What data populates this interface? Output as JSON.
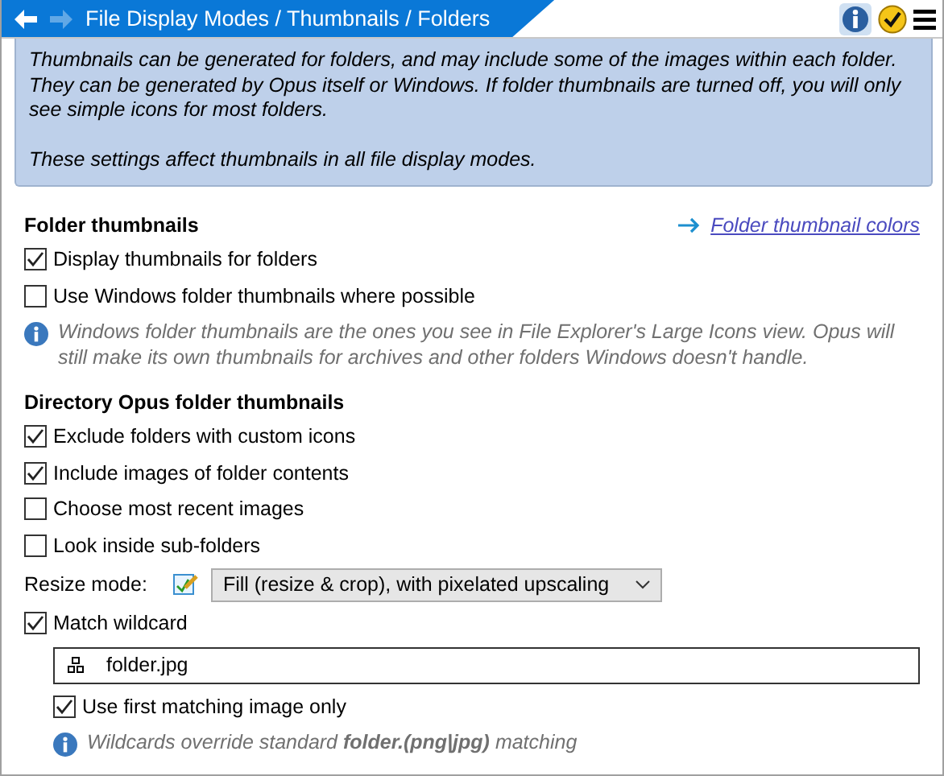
{
  "header": {
    "breadcrumb": "File Display Modes / Thumbnails / Folders",
    "back_enabled": true,
    "forward_enabled": false
  },
  "info_panel": {
    "paragraphs": [
      "Thumbnails can be generated for folders, and may include some of the images within each folder. They can be generated by Opus itself or Windows. If folder thumbnails are turned off, you will only see simple icons for most folders.",
      "These settings affect thumbnails in all file display modes."
    ]
  },
  "sections": [
    {
      "title": "Folder thumbnails",
      "link": "Folder thumbnail colors",
      "items": [
        {
          "kind": "checkbox",
          "label": "Display thumbnails for folders",
          "checked": true
        },
        {
          "kind": "checkbox",
          "label": "Use Windows folder thumbnails where possible",
          "checked": false
        },
        {
          "kind": "note",
          "text": "Windows folder thumbnails are the ones you see in File Explorer's Large Icons view. Opus will still make its own thumbnails for archives and other folders Windows doesn't handle."
        }
      ]
    },
    {
      "title": "Directory Opus folder thumbnails",
      "items": [
        {
          "kind": "checkbox",
          "label": "Exclude folders with custom icons",
          "checked": true
        },
        {
          "kind": "checkbox",
          "label": "Include images of folder contents",
          "checked": true
        },
        {
          "kind": "checkbox",
          "label": "Choose most recent images",
          "checked": false
        },
        {
          "kind": "checkbox",
          "label": "Look inside sub-folders",
          "checked": false
        },
        {
          "kind": "dropdown",
          "label": "Resize mode:",
          "value": "Fill (resize & crop), with pixelated upscaling"
        },
        {
          "kind": "checkbox",
          "label": "Match wildcard",
          "checked": true
        },
        {
          "kind": "field",
          "value": "folder.jpg"
        },
        {
          "kind": "subcheckbox",
          "label": "Use first matching image only",
          "checked": true
        },
        {
          "kind": "subnote",
          "text": "Wildcards override standard **folder.(png|jpg)** matching"
        }
      ]
    }
  ]
}
